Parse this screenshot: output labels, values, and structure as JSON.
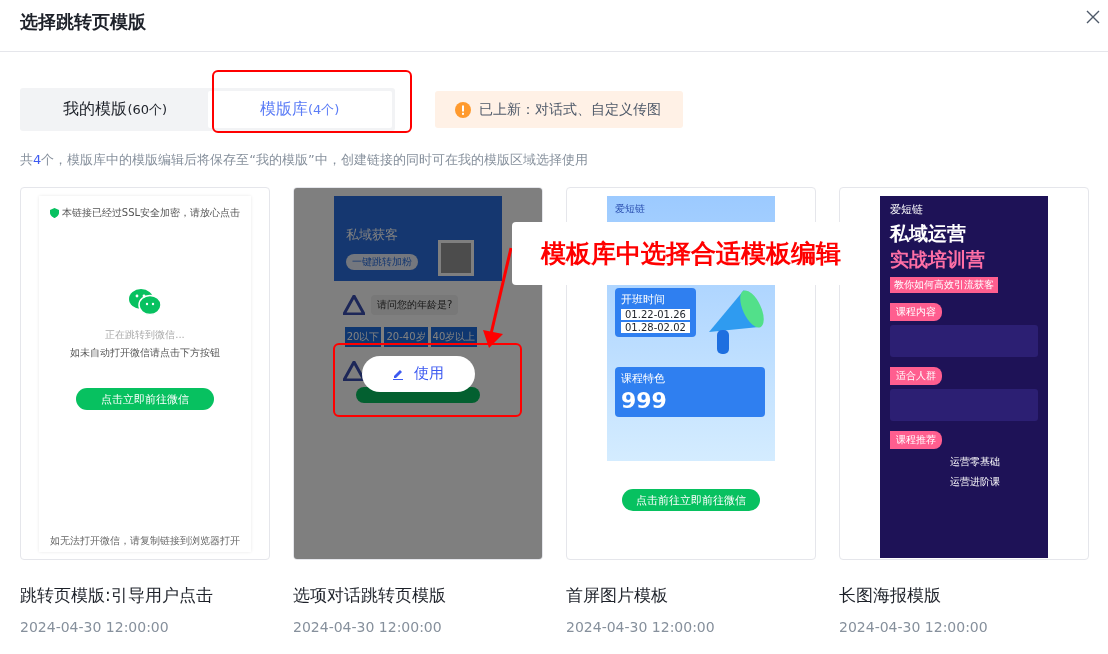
{
  "dialog": {
    "title": "选择跳转页模版"
  },
  "tabs": [
    {
      "label": "我的模版",
      "count": "(60个)",
      "selected": false
    },
    {
      "label": "模版库",
      "count": "(4个)",
      "selected": true
    }
  ],
  "notice": "已上新：对话式、自定义传图",
  "summary": {
    "prefix": "共",
    "count": "4",
    "text": "个，模版库中的模版编辑后将保存至“我的模版”中，创建链接的同时可在我的模版区域选择使用"
  },
  "templates": [
    {
      "kind": "redirect",
      "name": "跳转页模版:引导用户点击",
      "date": "2024-04-30 12:00:00",
      "hovered": false,
      "preview": {
        "secure": "本链接已经过SSL安全加密，请放心点击",
        "status": "正在跳转到微信...",
        "hint": "如未自动打开微信请点击下方按钮",
        "button": "点击立即前往微信",
        "footer": "如无法打开微信，请复制链接到浏览器打开"
      }
    },
    {
      "kind": "dialog",
      "name": "选项对话跳转页模版",
      "date": "2024-04-30 12:00:00",
      "hovered": true,
      "action": "使用",
      "preview": {
        "headline": "私域获客",
        "cta": "一键跳转加粉",
        "question": "请问您的年龄是?",
        "options": [
          "20以下",
          "20-40岁",
          "40岁以上"
        ]
      }
    },
    {
      "kind": "image",
      "name": "首屏图片模板",
      "date": "2024-04-30 12:00:00",
      "hovered": false,
      "preview": {
        "brand": "爱短链",
        "schedule_title": "开班时间",
        "dates": [
          "01.22-01.26",
          "01.28-02.02"
        ],
        "feature_title": "课程特色",
        "price": "999",
        "button": "点击前往立即前往微信"
      }
    },
    {
      "kind": "poster",
      "name": "长图海报模版",
      "date": "2024-04-30 12:00:00",
      "hovered": false,
      "preview": {
        "brand": "爱短链",
        "title_lines": [
          "私域运营",
          "实战培训营"
        ],
        "subtitle": "教你如何高效引流获客",
        "sections": [
          "课程内容",
          "适合人群",
          "课程推荐"
        ],
        "courses": [
          "运营零基础",
          "运营进阶课"
        ]
      }
    }
  ],
  "annotation": {
    "callout": "模板库中选择合适模板编辑"
  }
}
